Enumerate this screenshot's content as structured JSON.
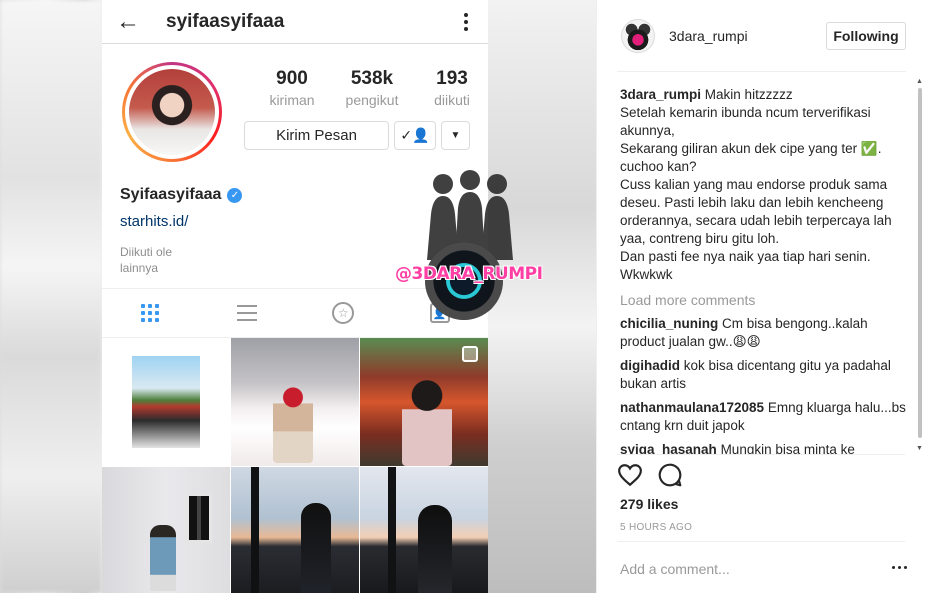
{
  "phone": {
    "header": {
      "username": "syifaasyifaaa"
    },
    "stats": [
      {
        "num": "900",
        "label": "kiriman"
      },
      {
        "num": "538k",
        "label": "pengikut"
      },
      {
        "num": "193",
        "label": "diikuti"
      }
    ],
    "message_button": "Kirim Pesan",
    "bio": {
      "name": "Syifaasyifaaa",
      "link": "starhits.id/",
      "followed_line1": "Diikuti ole",
      "followed_line2": "lainnya"
    }
  },
  "watermark": {
    "text": "@3DARA_RUMPI"
  },
  "panel": {
    "header": {
      "username": "3dara_rumpi",
      "following_label": "Following"
    },
    "caption": {
      "username": "3dara_rumpi",
      "text": " Makin hitzzzzz\nSetelah kemarin ibunda ncum terverifikasi akunnya,\nSekarang giliran akun dek cipe yang ter ✅.\ncuchoo kan?\nCuss kalian yang mau endorse produk sama deseu. Pasti lebih laku dan lebih kencheeng orderannya, secara udah lebih terpercaya lah yaa, contreng biru gitu loh.\nDan pasti fee nya naik yaa tiap hari senin. Wkwkwk"
    },
    "load_more": "Load more comments",
    "comments": [
      {
        "username": "chicilia_nuning",
        "text": " Cm bisa bengong..kalah product jualan gw..😩😩"
      },
      {
        "username": "digihadid",
        "text": " kok bisa dicentang gitu ya padahal bukan artis"
      },
      {
        "username": "nathanmaulana172085",
        "text": " Emng kluarga halu...bs cntang krn duit japok"
      },
      {
        "username": "syiqa_hasanah",
        "text": " Mungkin bisa minta ke"
      }
    ],
    "likes": "279 likes",
    "time": "5 HOURS AGO",
    "add_comment_placeholder": "Add a comment..."
  }
}
